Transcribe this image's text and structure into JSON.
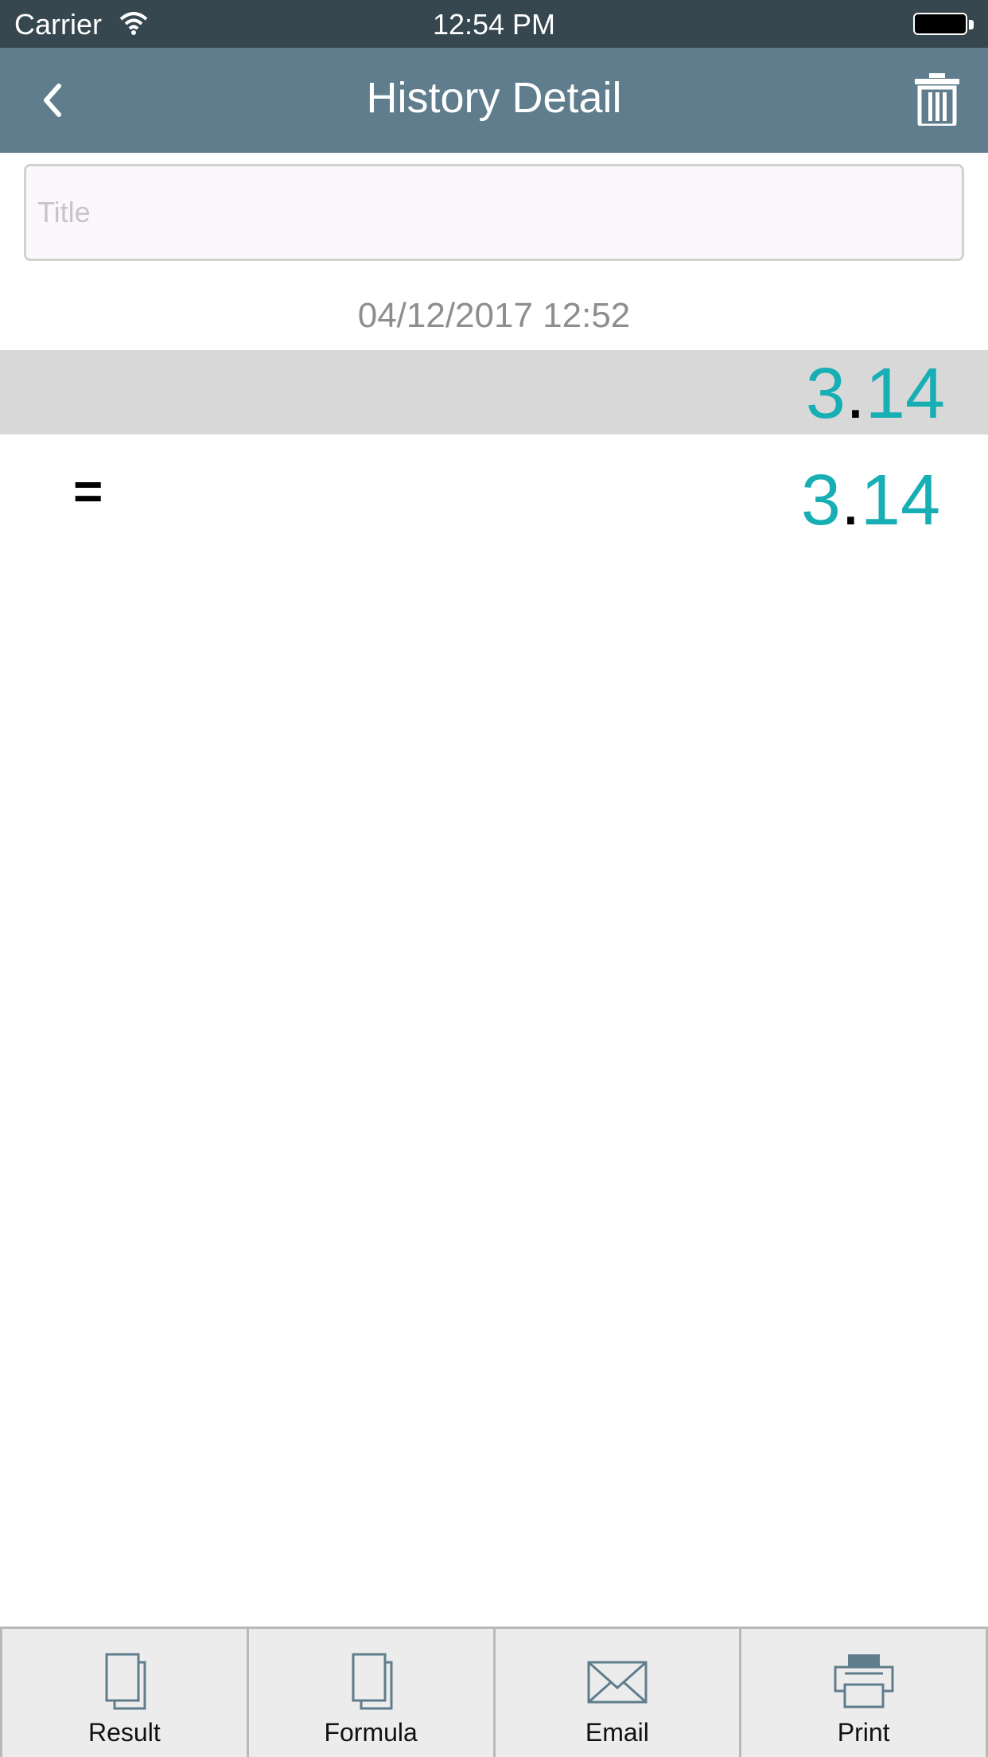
{
  "status": {
    "carrier": "Carrier",
    "time": "12:54 PM"
  },
  "header": {
    "title": "History Detail",
    "back_icon": "chevron-left-icon",
    "delete_icon": "trash-icon"
  },
  "title_field": {
    "placeholder": "Title",
    "value": ""
  },
  "entry": {
    "datetime": "04/12/2017 12:52",
    "result": {
      "int": "3",
      "dot": ".",
      "frac": "14"
    },
    "formula": {
      "operator": "=",
      "int": "3",
      "dot": ".",
      "frac": "14"
    }
  },
  "toolbar": {
    "items": [
      {
        "label": "Result",
        "icon": "copy-icon"
      },
      {
        "label": "Formula",
        "icon": "copy-icon"
      },
      {
        "label": "Email",
        "icon": "envelope-icon"
      },
      {
        "label": "Print",
        "icon": "printer-icon"
      }
    ]
  },
  "colors": {
    "header_bg": "#5f7d8c",
    "status_bg": "#37474f",
    "accent_number": "#17aeb4",
    "icon_stroke": "#5f7d8c"
  }
}
